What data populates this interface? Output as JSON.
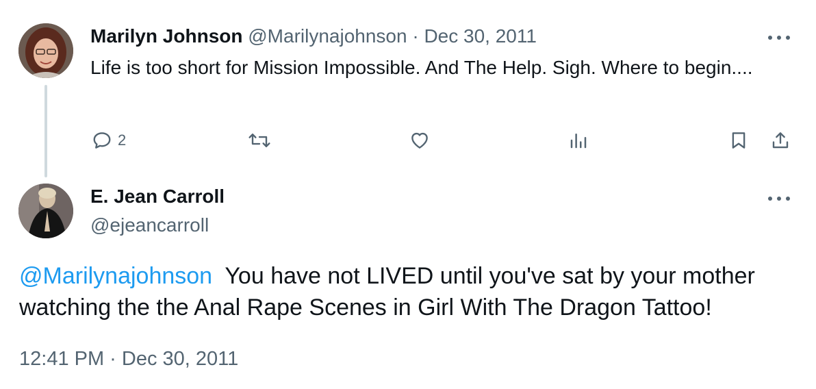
{
  "tweet1": {
    "display_name": "Marilyn Johnson",
    "handle": "@Marilynajohnson",
    "separator": "·",
    "date": "Dec 30, 2011",
    "text": "Life is too short for Mission Impossible. And The Help. Sigh. Where to begin....",
    "reply_count": "2"
  },
  "tweet2": {
    "display_name": "E. Jean Carroll",
    "handle": "@ejeancarroll",
    "mention": "@Marilynajohnson",
    "text": "You have not LIVED until you've sat by your mother watching the the Anal Rape Scenes in Girl With The Dragon Tattoo!",
    "timestamp": "12:41 PM · Dec 30, 2011"
  },
  "icons": {
    "reply": "reply-icon",
    "retweet": "retweet-icon",
    "like": "heart-icon",
    "views": "views-icon",
    "bookmark": "bookmark-icon",
    "share": "share-icon",
    "more": "more-icon"
  },
  "colors": {
    "text": "#0f1419",
    "muted": "#536471",
    "link": "#1d9bf0",
    "thread_line": "#cfd9de"
  }
}
